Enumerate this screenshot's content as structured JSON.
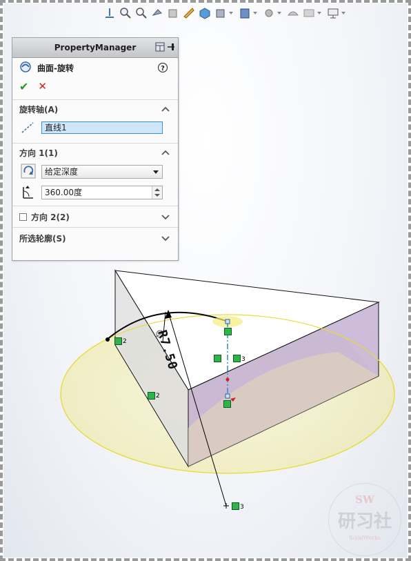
{
  "property_manager": {
    "header_title": "PropertyManager",
    "feature_title": "曲面-旋转",
    "help_glyph": "?",
    "ok_glyph": "✔",
    "cancel_glyph": "✕",
    "sections": {
      "axis": {
        "title": "旋转轴(A)",
        "value": "直线1"
      },
      "direction1": {
        "title": "方向 1(1)",
        "end_condition": "给定深度",
        "angle": "360.00度"
      },
      "direction2": {
        "title": "方向 2(2)",
        "checked": false
      },
      "contours": {
        "title": "所选轮廓(S)"
      }
    }
  },
  "toolbar": {
    "icons": [
      "view-normal-icon",
      "zoom-fit-icon",
      "zoom-area-icon",
      "previous-view-icon",
      "section-view-icon",
      "dynamic-annotation-icon",
      "view-orientation-icon",
      "display-style-icon",
      "hide-show-icon",
      "edit-appearance-icon",
      "apply-scene-icon",
      "view-setting-icon",
      "monitor-icon"
    ]
  },
  "sketch": {
    "dimension": "R7.50",
    "relation_numbers": [
      "2",
      "2",
      "3",
      "3",
      "3"
    ]
  },
  "watermark": {
    "sw": "SW",
    "main": "研习社",
    "small": "SolidWorks"
  },
  "colors": {
    "accent": "#3c8fd6",
    "selection_fill": "#cfe6f8",
    "preview_yellow": "#f3ee9a",
    "part_purple": "#c9b6d6",
    "relation_green": "#2fb34a",
    "ok_green": "#1f9a2c",
    "cancel_red": "#d42020"
  }
}
